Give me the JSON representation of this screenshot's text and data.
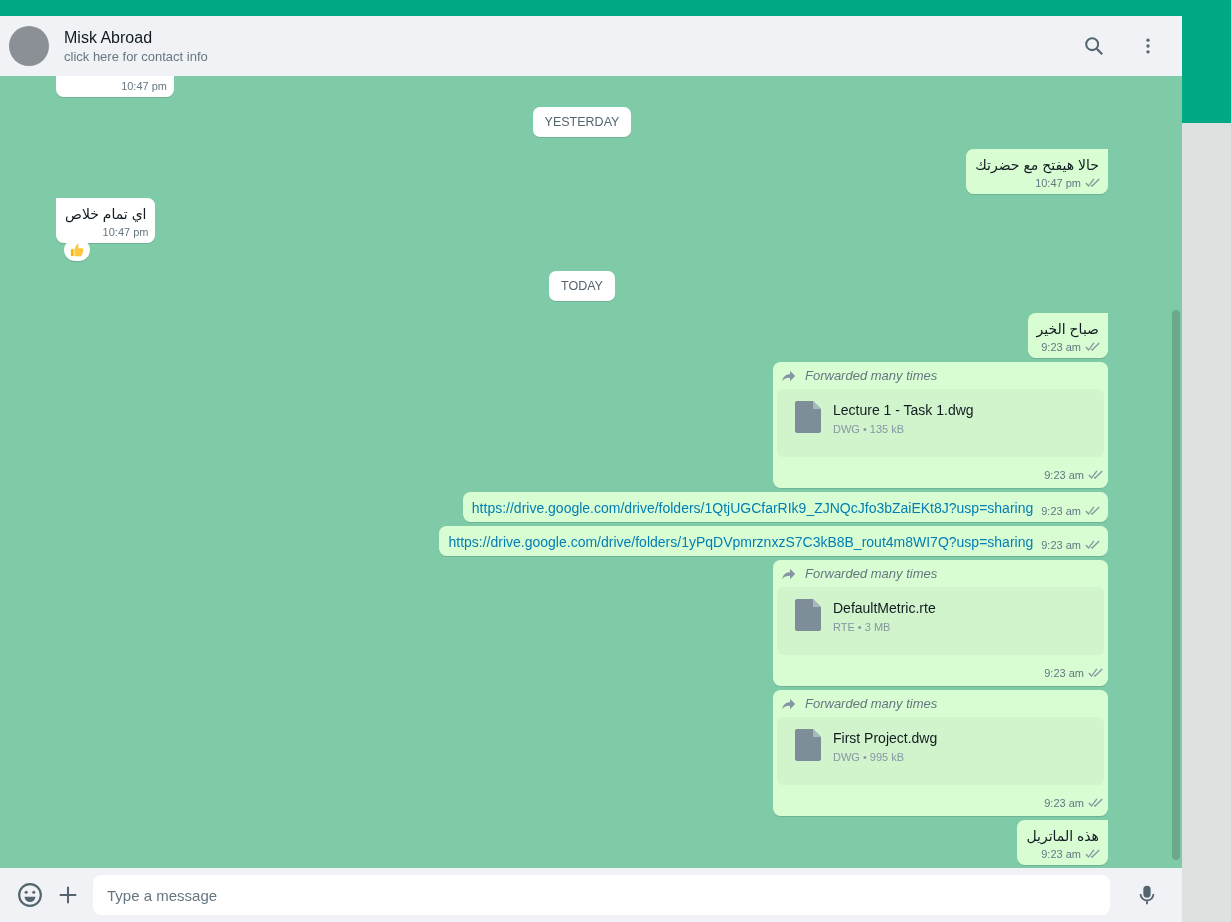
{
  "header": {
    "name": "Misk Abroad",
    "subtitle": "click here for contact info"
  },
  "messages": [
    {
      "kind": "text",
      "outgoing": false,
      "time": "10:47 pm",
      "cut": true
    },
    {
      "kind": "date",
      "label": "YESTERDAY"
    },
    {
      "kind": "text",
      "outgoing": true,
      "text": "حالا هيفتح مع حضرتك",
      "time": "10:47 pm",
      "read": false
    },
    {
      "kind": "text",
      "outgoing": false,
      "text": "اي تمام خلاص",
      "time": "10:47 pm",
      "reacted": true
    },
    {
      "kind": "date",
      "label": "TODAY"
    },
    {
      "kind": "text",
      "outgoing": true,
      "text": "صباح الخير",
      "time": "9:23 am",
      "read": false
    },
    {
      "kind": "file",
      "outgoing": true,
      "forwarded": "Forwarded many times",
      "file_name": "Lecture 1 - Task 1.dwg",
      "file_meta": "DWG • 135 kB",
      "time": "9:23 am",
      "read": false
    },
    {
      "kind": "link",
      "outgoing": true,
      "text": "https://drive.google.com/drive/folders/1QtjUGCfarRIk9_ZJNQcJfo3bZaiEKt8J?usp=sharing",
      "time": "9:23 am",
      "read": false
    },
    {
      "kind": "link",
      "outgoing": true,
      "text": "https://drive.google.com/drive/folders/1yPqDVpmrznxzS7C3kB8B_rout4m8WI7Q?usp=sharing",
      "time": "9:23 am",
      "read": false
    },
    {
      "kind": "file",
      "outgoing": true,
      "forwarded": "Forwarded many times",
      "file_name": "DefaultMetric.rte",
      "file_meta": "RTE • 3 MB",
      "time": "9:23 am",
      "read": false
    },
    {
      "kind": "file",
      "outgoing": true,
      "forwarded": "Forwarded many times",
      "file_name": "First Project.dwg",
      "file_meta": "DWG • 995 kB",
      "time": "9:23 am",
      "read": false
    },
    {
      "kind": "text",
      "outgoing": true,
      "text": "هذه الماتريل",
      "time": "9:23 am",
      "read": false
    }
  ],
  "composer": {
    "placeholder": "Type a message"
  }
}
